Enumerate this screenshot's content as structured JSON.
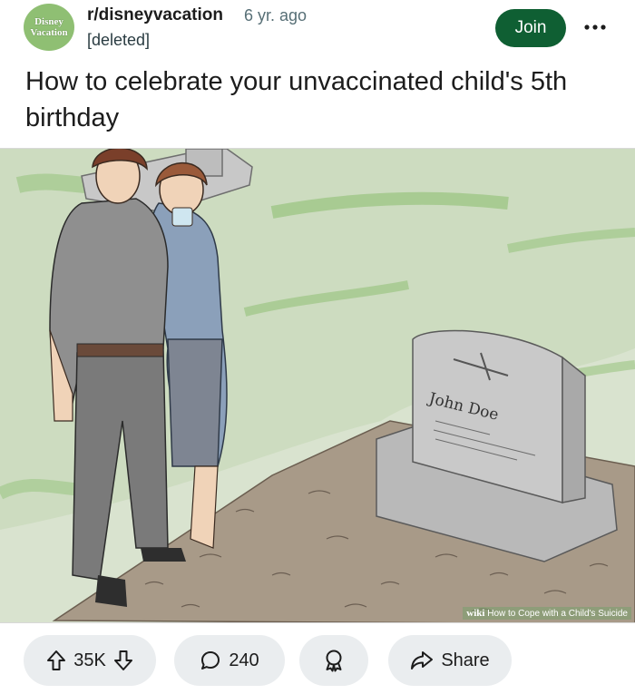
{
  "post": {
    "subreddit_avatar_lines": [
      "Disney",
      "Vacation"
    ],
    "subreddit": "r/disneyvacation",
    "age": "6 yr. ago",
    "author": "[deleted]",
    "join_label": "Join",
    "more_icon": "more-horizontal-icon",
    "title": "How to celebrate your unvaccinated child's 5th birthday"
  },
  "image": {
    "headstone_name": "John Doe",
    "watermark_brand": "wiki",
    "watermark_text": "How to Cope with a Child's Suicide"
  },
  "actions": {
    "upvote_icon": "arrow-up-icon",
    "vote_count": "35K",
    "downvote_icon": "arrow-down-icon",
    "comment_icon": "comment-bubble-icon",
    "comment_count": "240",
    "award_icon": "award-icon",
    "share_icon": "share-arrow-icon",
    "share_label": "Share"
  },
  "colors": {
    "join_button": "#0f5f33",
    "pill_background": "#eaedef",
    "avatar_green": "#8fbf73"
  }
}
